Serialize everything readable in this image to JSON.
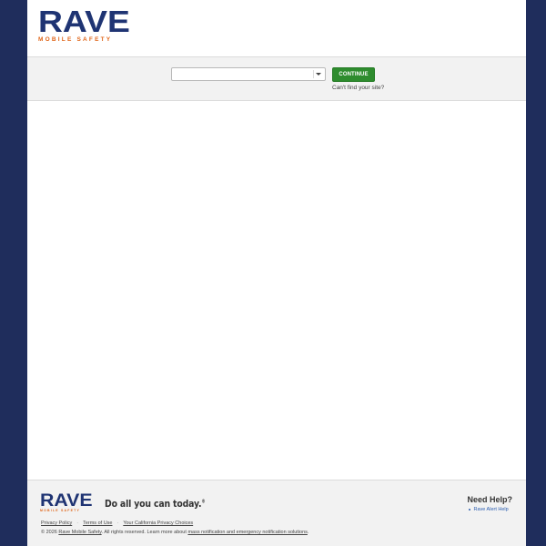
{
  "header": {
    "logo_text": "RAVE",
    "logo_subtext": "MOBILE SAFETY"
  },
  "site_selector": {
    "selected_value": "",
    "continue_label": "CONTINUE",
    "cant_find_label": "Can't find your site?"
  },
  "footer": {
    "logo_text": "RAVE",
    "logo_subtext": "MOBILE SAFETY",
    "tagline": "Do all you can today.",
    "tagline_mark": "®",
    "links": {
      "privacy": "Privacy Policy",
      "terms": "Terms of Use",
      "california": "Your California Privacy Choices"
    },
    "copyright_prefix": "© 2026",
    "copyright_company": "Rave Mobile Safety",
    "copyright_middle": ". All rights reserved. Learn more about",
    "copyright_link": "mass notification and emergency notification solutions",
    "copyright_suffix": ".",
    "help_title": "Need Help?",
    "help_items": [
      "Rave Alert Help"
    ]
  },
  "colors": {
    "background": "#1f2d5c",
    "brand_blue": "#1f3473",
    "brand_orange": "#e0661a",
    "continue_green": "#2e8c2e",
    "link_blue": "#2a5db0"
  }
}
